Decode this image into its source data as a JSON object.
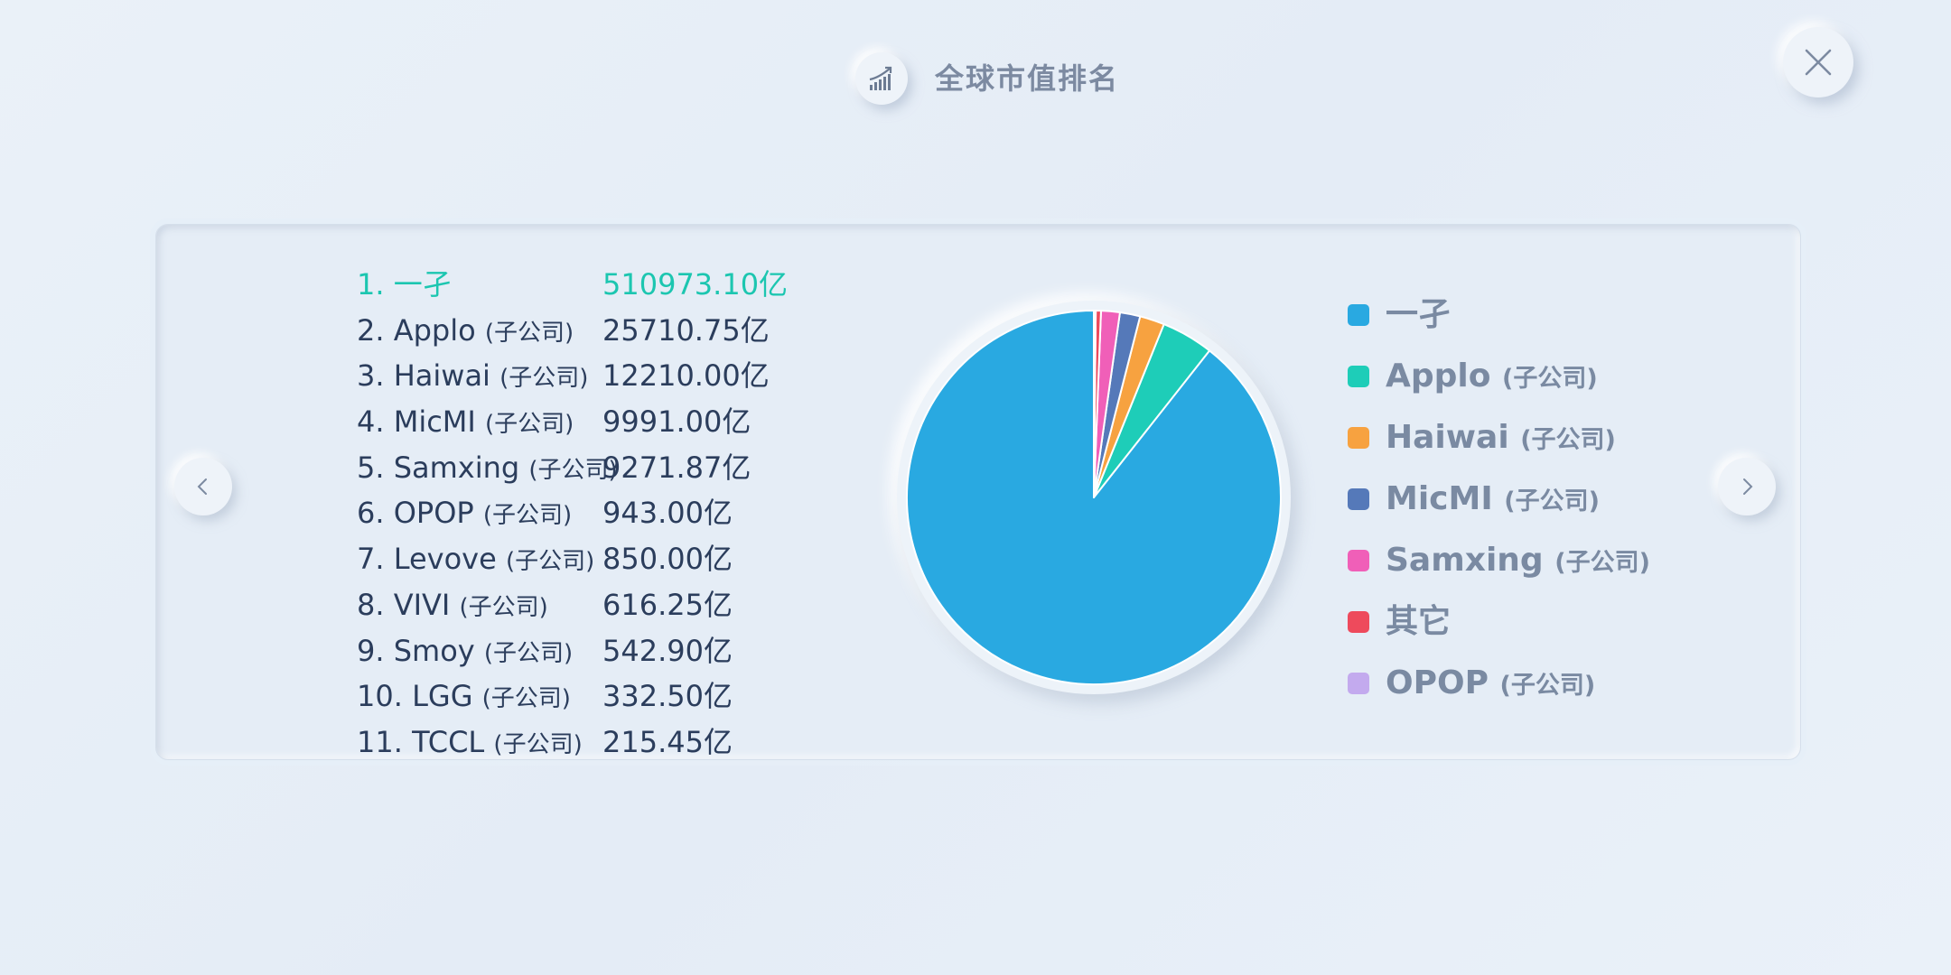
{
  "header": {
    "title": "全球市值排名",
    "icon": "trending-chart-icon"
  },
  "close_icon": "close-icon",
  "nav": {
    "prev_icon": "chevron-left-icon",
    "next_icon": "chevron-right-icon"
  },
  "ranking": [
    {
      "rank": "1.",
      "name": "一孑",
      "suffix": "",
      "value": "510973.10亿"
    },
    {
      "rank": "2.",
      "name": "Applo",
      "suffix": "(子公司)",
      "value": "25710.75亿"
    },
    {
      "rank": "3.",
      "name": "Haiwai",
      "suffix": "(子公司)",
      "value": "12210.00亿"
    },
    {
      "rank": "4.",
      "name": "MicMI",
      "suffix": "(子公司)",
      "value": "9991.00亿"
    },
    {
      "rank": "5.",
      "name": "Samxing",
      "suffix": "(子公司)",
      "value": "9271.87亿"
    },
    {
      "rank": "6.",
      "name": "OPOP",
      "suffix": "(子公司)",
      "value": "943.00亿"
    },
    {
      "rank": "7.",
      "name": "Levove",
      "suffix": "(子公司)",
      "value": "850.00亿"
    },
    {
      "rank": "8.",
      "name": "VIVI",
      "suffix": "(子公司)",
      "value": "616.25亿"
    },
    {
      "rank": "9.",
      "name": "Smoy",
      "suffix": "(子公司)",
      "value": "542.90亿"
    },
    {
      "rank": "10.",
      "name": "LGG",
      "suffix": "(子公司)",
      "value": "332.50亿"
    },
    {
      "rank": "11.",
      "name": "TCCL",
      "suffix": "(子公司)",
      "value": "215.45亿"
    }
  ],
  "colors": {
    "accent_first": "#1cc6b0",
    "text": "#2b3d5c",
    "legend_text": "#7a8aa2"
  },
  "chart_data": {
    "type": "pie",
    "categories": [
      "一孑",
      "Applo (子公司)",
      "Haiwai (子公司)",
      "MicMI (子公司)",
      "Samxing (子公司)",
      "其它",
      "OPOP (子公司)"
    ],
    "values": [
      510973.1,
      25710.75,
      12210.0,
      9991.0,
      9271.87,
      2557.1,
      943.0
    ],
    "colors": [
      "#29a9e1",
      "#1ecdb8",
      "#f7a240",
      "#5579b9",
      "#f05fb8",
      "#ee4a5c",
      "#c3aaee"
    ],
    "legend": [
      {
        "name": "一孑",
        "suffix": "",
        "color": "#29a9e1"
      },
      {
        "name": "Applo",
        "suffix": "(子公司)",
        "color": "#1ecdb8"
      },
      {
        "name": "Haiwai",
        "suffix": "(子公司)",
        "color": "#f7a240"
      },
      {
        "name": "MicMI",
        "suffix": "(子公司)",
        "color": "#5579b9"
      },
      {
        "name": "Samxing",
        "suffix": "(子公司)",
        "color": "#f05fb8"
      },
      {
        "name": "其它",
        "suffix": "",
        "color": "#ee4a5c"
      },
      {
        "name": "OPOP",
        "suffix": "(子公司)",
        "color": "#c3aaee"
      }
    ],
    "legend_position": "right",
    "start_angle_deg": 0,
    "direction": "counterclockwise"
  }
}
